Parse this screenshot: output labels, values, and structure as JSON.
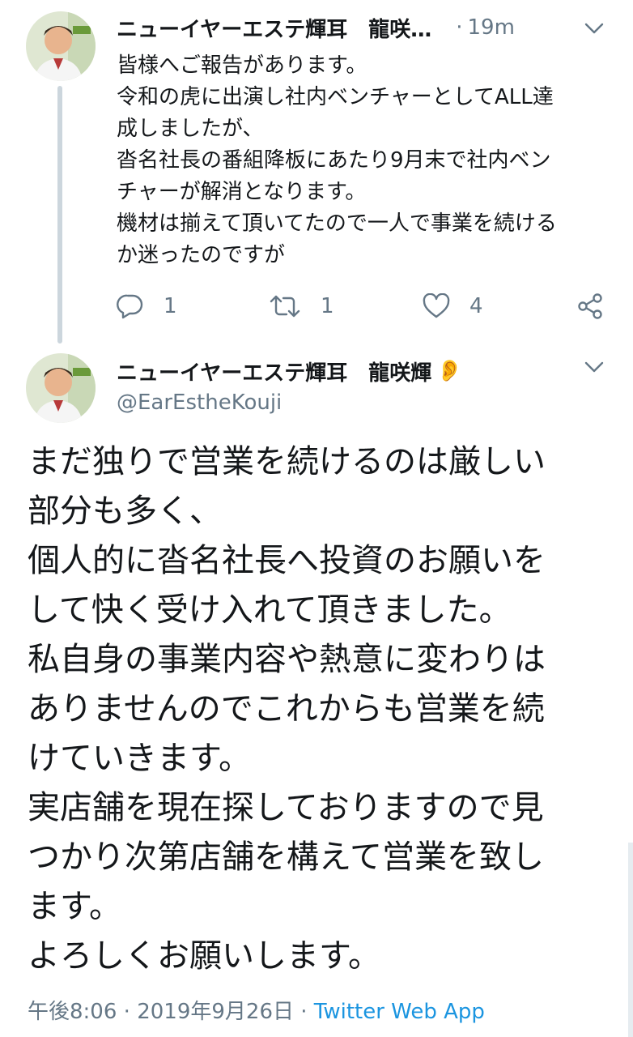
{
  "tweet1": {
    "display_name": "ニューイヤーエステ輝耳　龍咲…",
    "separator": "·",
    "time": "19m",
    "lines": [
      "皆様へご報告があります。",
      "令和の虎に出演し社内ベンチャーとしてALL達",
      "成しましたが、",
      "沓名社長の番組降板にあたり9月末で社内ベン",
      "チャーが解消となります。",
      "機材は揃えて頂いてたので一人で事業を続ける",
      "か迷ったのですが"
    ],
    "reply_count": "1",
    "retweet_count": "1",
    "like_count": "4",
    "icons": {
      "reply": "reply-icon",
      "retweet": "retweet-icon",
      "like": "heart-icon",
      "share": "share-icon",
      "menu": "chevron-down-icon"
    }
  },
  "tweet2": {
    "display_name": "ニューイヤーエステ輝耳　龍咲輝",
    "emoji": "👂",
    "handle": "@EarEstheKouji",
    "lines": [
      "まだ独りで営業を続けるのは厳しい",
      "部分も多く、",
      "個人的に沓名社長へ投資のお願いを",
      "して快く受け入れて頂きました。",
      "私自身の事業内容や熱意に変わりは",
      "ありませんのでこれからも営業を続",
      "けていきます。",
      "実店舗を現在探しておりますので見",
      "つかり次第店舗を構えて営業を致し",
      "ます。",
      "よろしくお願いします。"
    ],
    "timestamp": "午後8:06",
    "date": "2019年9月26日",
    "separator": "·",
    "app": "Twitter Web App"
  },
  "colors": {
    "text": "#14171a",
    "secondary": "#657786",
    "link": "#1b95e0",
    "thread_line": "#ccd6dd"
  }
}
